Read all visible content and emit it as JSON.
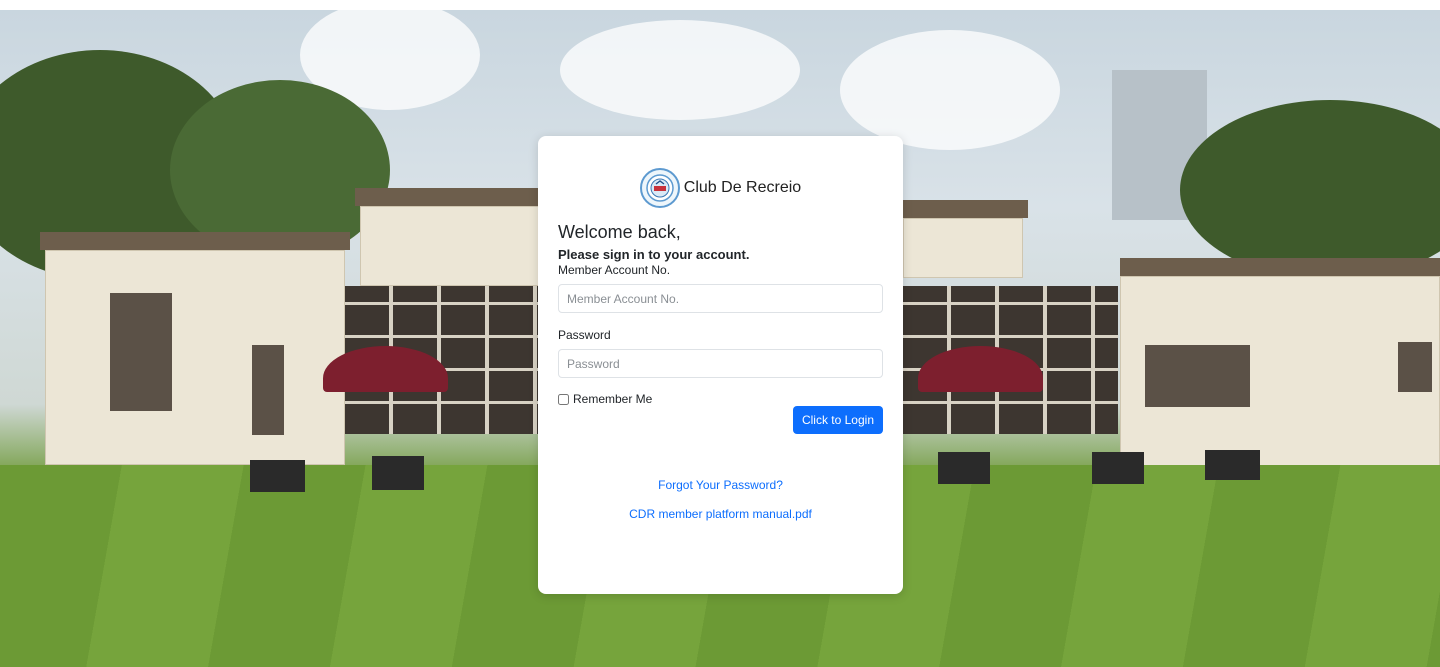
{
  "brand": {
    "name": "Club De Recreio",
    "logo_icon": "club-crest-icon"
  },
  "form": {
    "welcome": "Welcome back,",
    "subtitle": "Please sign in to your account.",
    "account_label": "Member Account No.",
    "account_placeholder": "Member Account No.",
    "password_label": "Password",
    "password_placeholder": "Password",
    "remember_label": "Remember Me",
    "login_button": "Click to Login"
  },
  "links": {
    "forgot_password": "Forgot Your Password?",
    "manual": "CDR member platform manual.pdf"
  },
  "colors": {
    "primary": "#0d6efd",
    "card_bg": "#ffffff"
  }
}
